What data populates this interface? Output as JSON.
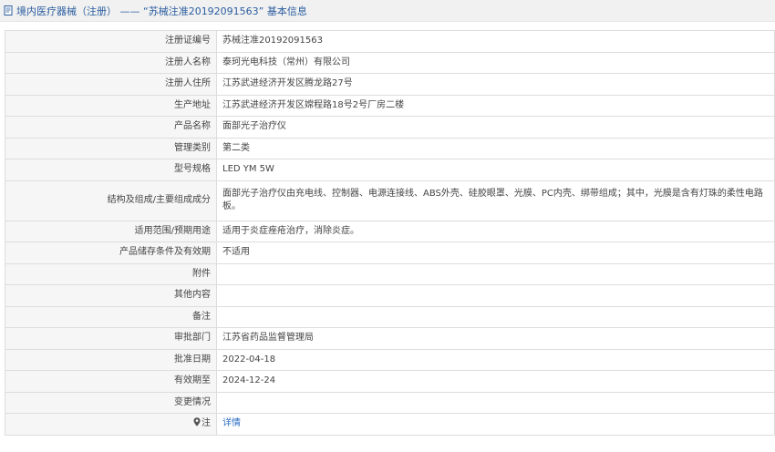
{
  "header": {
    "title": "境内医疗器械（注册） —— “苏械注准20192091563” 基本信息"
  },
  "rows": [
    {
      "label": "注册证编号",
      "value": "苏械注准20192091563"
    },
    {
      "label": "注册人名称",
      "value": "泰珂光电科技（常州）有限公司"
    },
    {
      "label": "注册人住所",
      "value": "江苏武进经济开发区腾龙路27号"
    },
    {
      "label": "生产地址",
      "value": "江苏武进经济开发区嫦程路18号2号厂房二楼"
    },
    {
      "label": "产品名称",
      "value": "面部光子治疗仪"
    },
    {
      "label": "管理类别",
      "value": "第二类"
    },
    {
      "label": "型号规格",
      "value": "LED YM 5W"
    },
    {
      "label": "结构及组成/主要组成成分",
      "value": "面部光子治疗仪由充电线、控制器、电源连接线、ABS外壳、硅胶眼罩、光膜、PC内壳、绑带组成；其中，光膜是含有灯珠的柔性电路板。"
    },
    {
      "label": "适用范围/预期用途",
      "value": "适用于炎症痤疮治疗，消除炎症。"
    },
    {
      "label": "产品储存条件及有效期",
      "value": "不适用"
    },
    {
      "label": "附件",
      "value": ""
    },
    {
      "label": "其他内容",
      "value": ""
    },
    {
      "label": "备注",
      "value": ""
    },
    {
      "label": "审批部门",
      "value": "江苏省药品监督管理局"
    },
    {
      "label": "批准日期",
      "value": "2022-04-18"
    },
    {
      "label": "有效期至",
      "value": "2024-12-24"
    },
    {
      "label": "变更情况",
      "value": ""
    }
  ],
  "note": {
    "label": "注",
    "link_text": "详情",
    "icon": "map-pin-icon"
  },
  "colors": {
    "title_text": "#2a5d9f",
    "label_bg": "#f6f6f6",
    "border": "#dddddd",
    "link": "#2a6cc1"
  }
}
